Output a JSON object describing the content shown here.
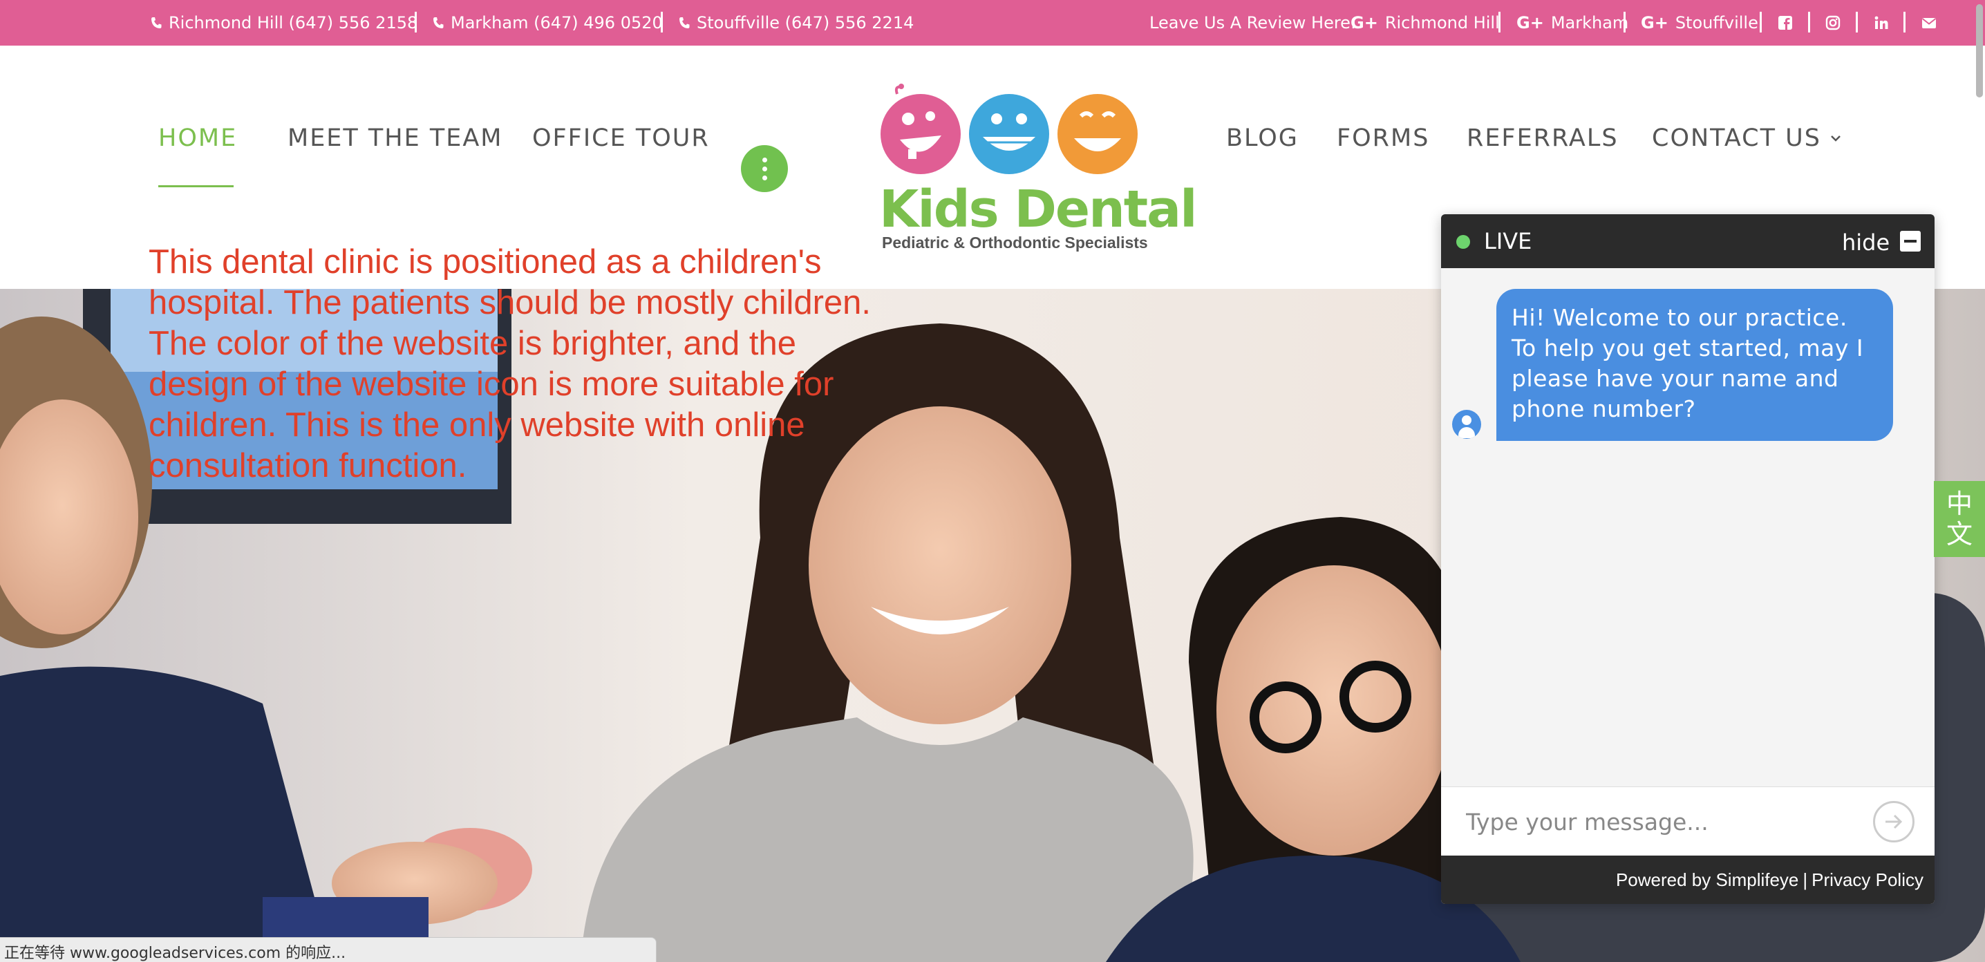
{
  "topbar": {
    "phones": [
      {
        "label": "Richmond Hill (647) 556 2158"
      },
      {
        "label": "Markham (647) 496 0520"
      },
      {
        "label": "Stouffville (647) 556 2214"
      }
    ],
    "review_label": "Leave Us A Review Here:",
    "review_links": [
      {
        "label": "Richmond Hill"
      },
      {
        "label": "Markham"
      },
      {
        "label": "Stouffville"
      }
    ],
    "social_icons": [
      "facebook-icon",
      "instagram-icon",
      "linkedin-icon",
      "email-icon"
    ]
  },
  "nav": {
    "left": [
      "HOME",
      "MEET THE TEAM",
      "OFFICE TOUR"
    ],
    "right": [
      "BLOG",
      "FORMS",
      "REFERRALS",
      "CONTACT US"
    ],
    "active": "HOME"
  },
  "logo": {
    "name": "Kids Dental",
    "tagline": "Pediatric & Orthodontic Specialists"
  },
  "overlay_note": "This dental clinic is positioned as a children's hospital. The patients should be mostly children. The color of the website is brighter, and the design of the website icon is more suitable for children. This is the only website with online consultation function.",
  "chat": {
    "status": "LIVE",
    "hide_label": "hide",
    "message": "Hi! Welcome to our practice. To help you get started, may I please have your name and phone number?",
    "input_placeholder": "Type your message...",
    "powered_by": "Powered by Simplifeye",
    "separator": "|",
    "privacy": "Privacy Policy"
  },
  "lang_tab": {
    "line1": "中",
    "line2": "文"
  },
  "status_bar": "正在等待 www.googleadservices.com 的响应...",
  "colors": {
    "topbar": "#e05e94",
    "accent_green": "#7cbf4e",
    "chat_bubble": "#4a8ee0",
    "chat_dark": "#2b2b2b",
    "note_red": "#e0402a",
    "face_pink": "#e05e94",
    "face_blue": "#3ea7dc",
    "face_orange": "#f19a38"
  }
}
